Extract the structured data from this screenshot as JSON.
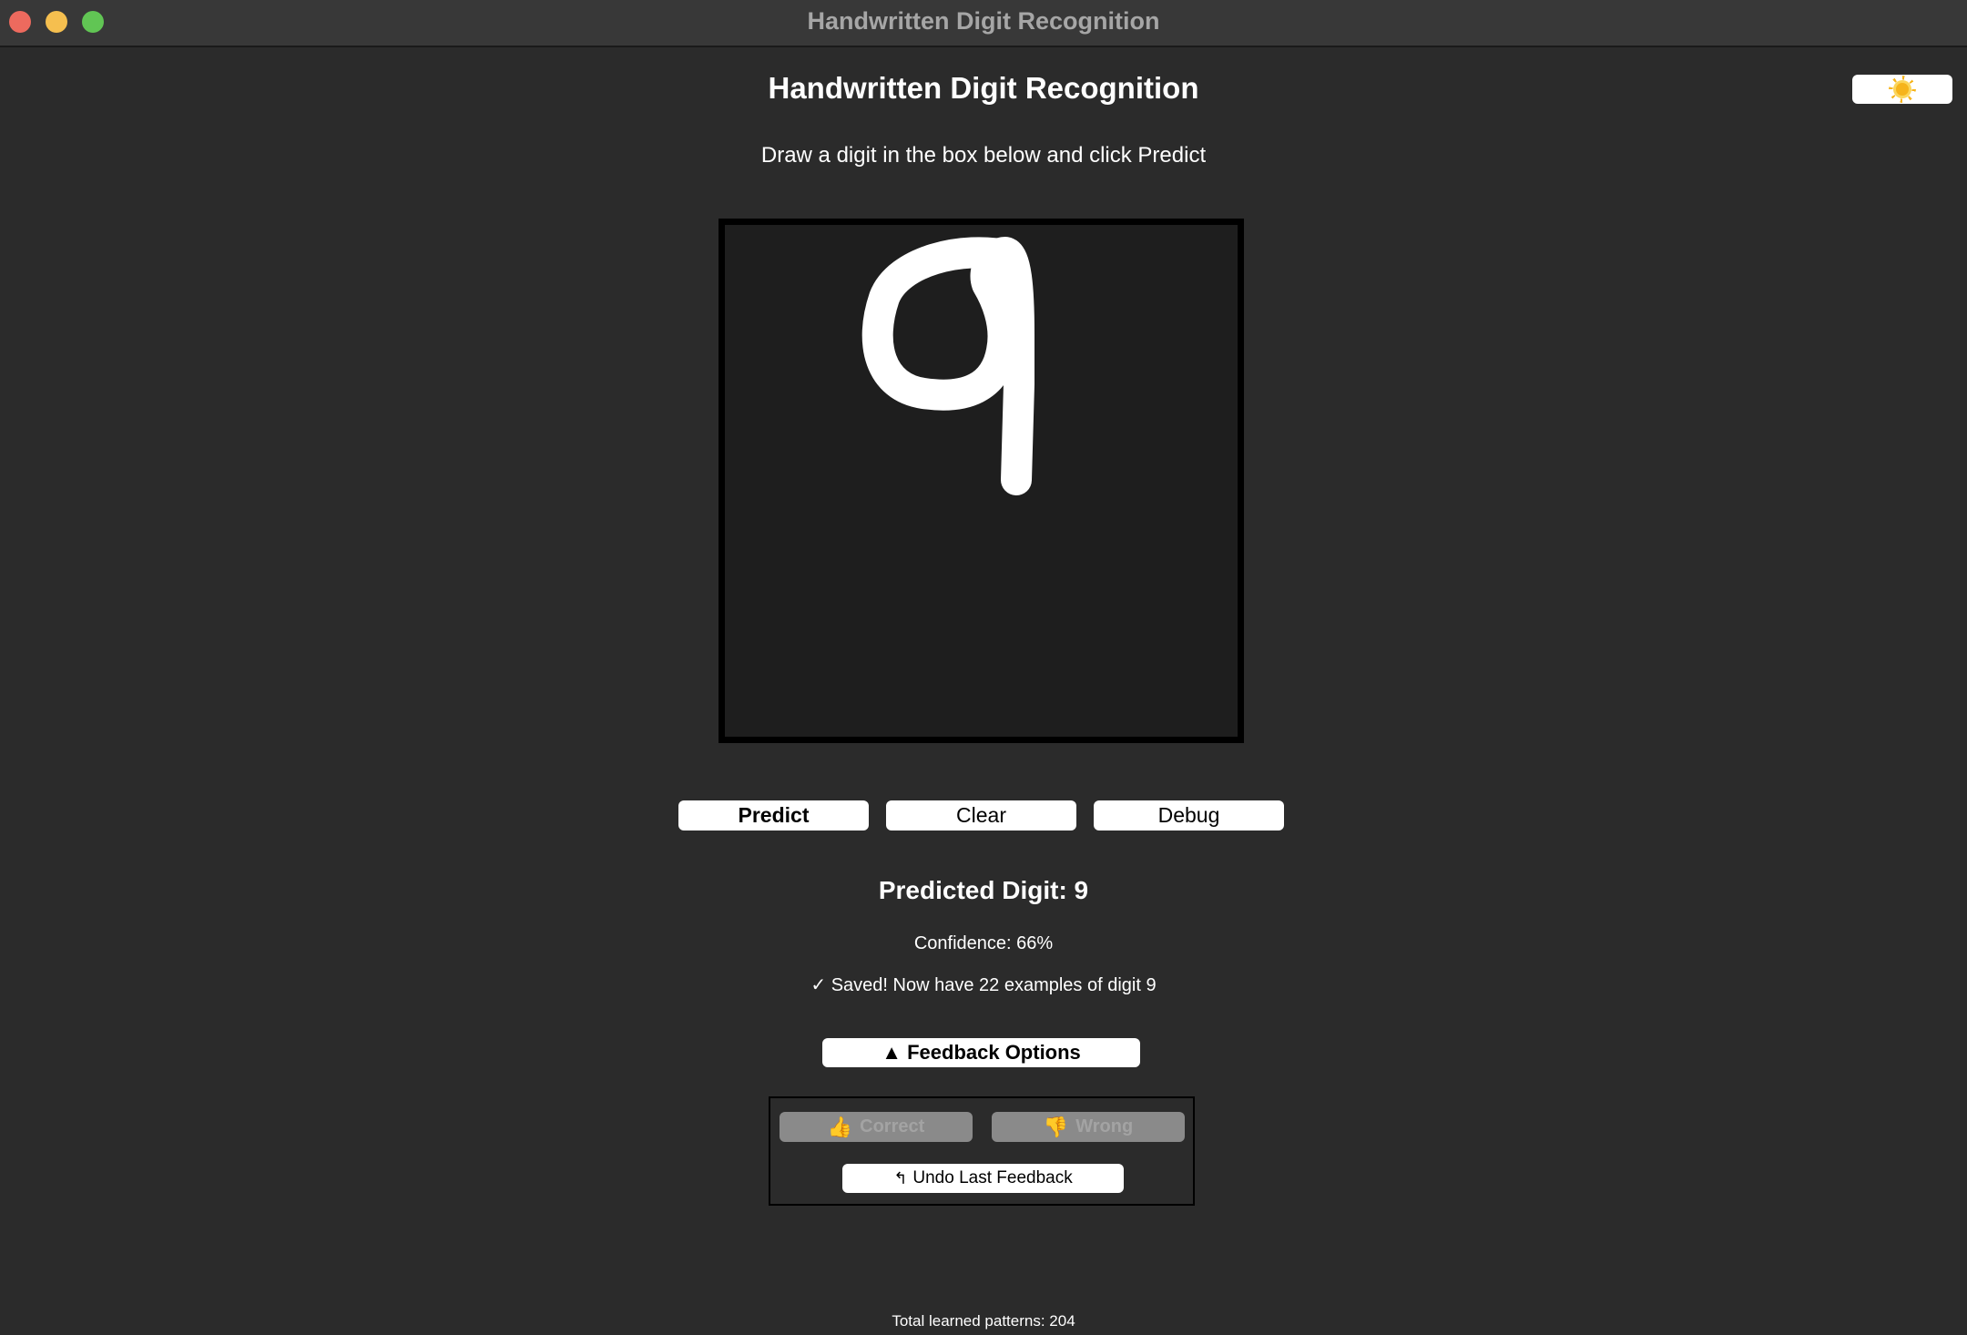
{
  "window": {
    "title": "Handwritten Digit Recognition"
  },
  "header": {
    "title": "Handwritten Digit Recognition",
    "instructions": "Draw a digit in the box below and click Predict",
    "theme_toggle_icon": "sun-icon"
  },
  "canvas": {
    "background": "#1e1e1e",
    "stroke_color": "#ffffff"
  },
  "controls": {
    "predict_label": "Predict",
    "clear_label": "Clear",
    "debug_label": "Debug"
  },
  "result": {
    "predicted": "Predicted Digit: 9",
    "confidence": "Confidence: 66%",
    "saved": "✓ Saved! Now have 22 examples of digit 9"
  },
  "feedback": {
    "toggle_label": "▲ Feedback Options",
    "correct_label": "Correct",
    "correct_icon": "thumbs-up-icon",
    "wrong_label": "Wrong",
    "wrong_icon": "thumbs-down-icon",
    "undo_label": "Undo Last Feedback",
    "undo_icon": "undo-arrow-icon"
  },
  "footer": {
    "total_patterns": "Total learned patterns: 204"
  },
  "colors": {
    "window_bg": "#2b2b2b",
    "titlebar_bg": "#383838",
    "button_bg": "#ffffff",
    "disabled_button_bg": "#8a8a8a",
    "close": "#ed6a5e",
    "minimize": "#f5bf4f",
    "maximize": "#61c554"
  }
}
